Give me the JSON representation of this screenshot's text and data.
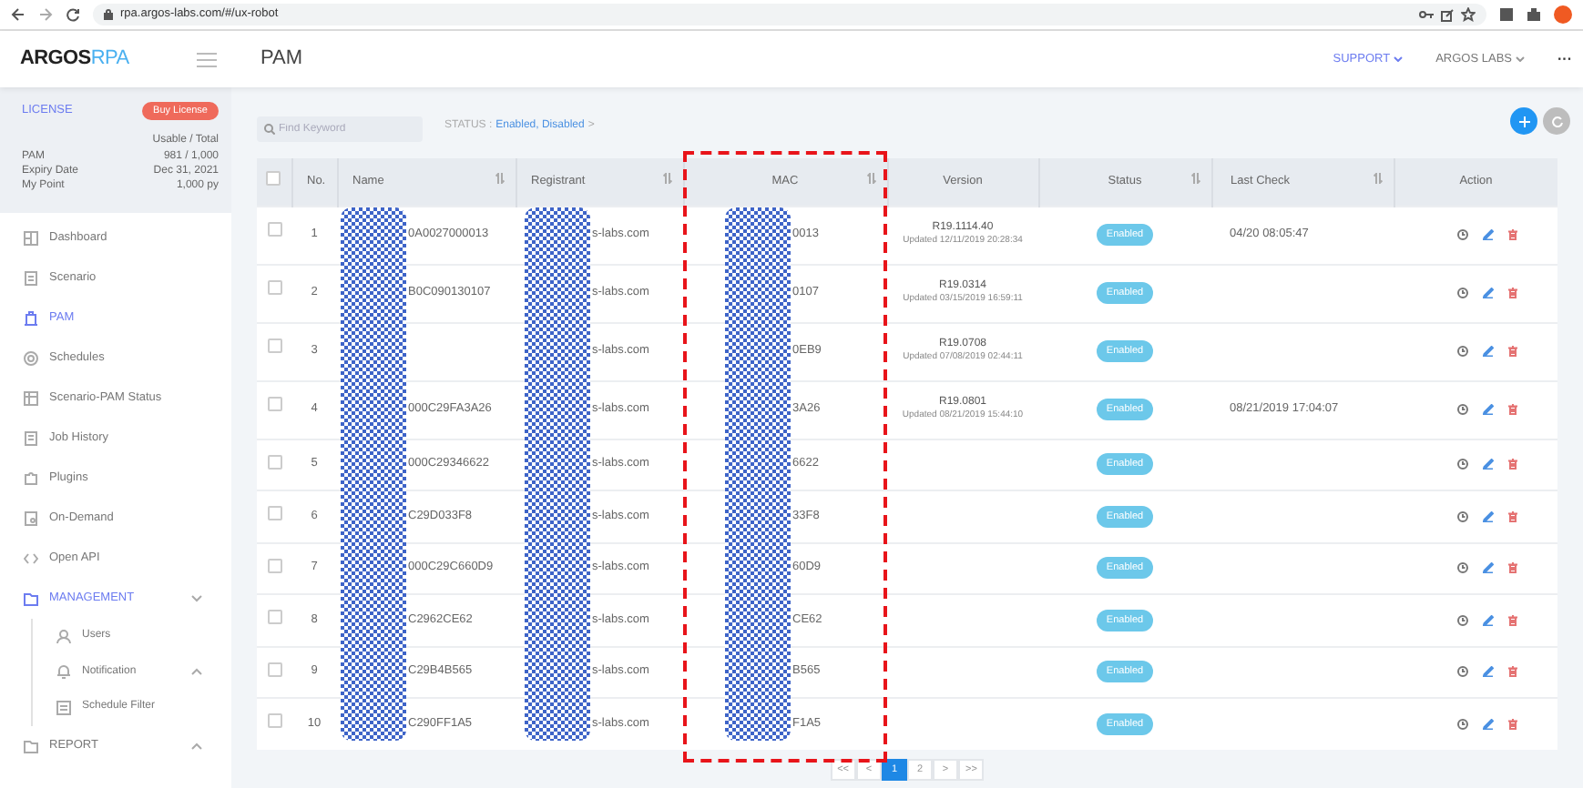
{
  "browser": {
    "url": "rpa.argos-labs.com/#/ux-robot"
  },
  "header": {
    "logo": {
      "text": "ARGOS",
      "accent": "RPA"
    },
    "title": "PAM",
    "menus": [
      {
        "label": "SUPPORT",
        "selected": true
      },
      {
        "label": "ARGOS LABS",
        "selected": false
      }
    ],
    "more": "···"
  },
  "license": {
    "title": "LICENSE",
    "buy_button": "Buy License",
    "caption": "Usable / Total",
    "rows": [
      {
        "label": "PAM",
        "value": "981 / 1,000"
      },
      {
        "label": "Expiry Date",
        "value": "Dec 31, 2021"
      },
      {
        "label": "My Point",
        "value": "1,000 py"
      }
    ]
  },
  "sidebar": {
    "items": [
      {
        "kind": "dashboard",
        "label": "Dashboard",
        "selected": false
      },
      {
        "kind": "scenario",
        "label": "Scenario",
        "selected": false
      },
      {
        "kind": "pam",
        "label": "PAM",
        "selected": true
      },
      {
        "kind": "schedules",
        "label": "Schedules",
        "selected": false
      },
      {
        "kind": "status",
        "label": "Scenario-PAM Status",
        "selected": false
      },
      {
        "kind": "history",
        "label": "Job History",
        "selected": false
      },
      {
        "kind": "plugins",
        "label": "Plugins",
        "selected": false
      },
      {
        "kind": "ondemand",
        "label": "On-Demand",
        "selected": false
      },
      {
        "kind": "api",
        "label": "Open API",
        "selected": false
      },
      {
        "kind": "folder",
        "label": "MANAGEMENT",
        "selected": true,
        "expanded": true,
        "children": [
          {
            "kind": "user",
            "label": "Users",
            "selected": false
          },
          {
            "kind": "bell",
            "label": "Notification",
            "selected": false,
            "expanded": false
          },
          {
            "kind": "filter",
            "label": "Schedule Filter",
            "selected": false
          }
        ]
      },
      {
        "kind": "folder",
        "label": "REPORT",
        "selected": false,
        "expanded": false
      }
    ]
  },
  "toolbar": {
    "search": {
      "placeholder": "Find Keyword"
    },
    "status_label": "STATUS :",
    "status_value": "Enabled, Disabled",
    "status_arrow": ">"
  },
  "table": {
    "select_all_checked": false,
    "columns": [
      {
        "kind": "check",
        "sortable": false
      },
      {
        "kind": "no",
        "label": "No.",
        "sortable": false
      },
      {
        "kind": "name",
        "label": "Name",
        "sortable": true,
        "redacted": true
      },
      {
        "kind": "registrant",
        "label": "Registrant",
        "sortable": true,
        "redacted": true
      },
      {
        "kind": "mac",
        "label": "MAC",
        "sortable": true,
        "redacted": true,
        "highlighted": true
      },
      {
        "kind": "version",
        "label": "Version",
        "sortable": false
      },
      {
        "kind": "status",
        "label": "Status",
        "sortable": true
      },
      {
        "kind": "last_check",
        "label": "Last Check",
        "sortable": true
      },
      {
        "kind": "action",
        "label": "Action",
        "sortable": false
      }
    ],
    "rows": [
      {
        "checked": false,
        "no": "1",
        "name": "0A0027000013",
        "registrant": "s-labs.com",
        "mac": "0013",
        "version": "R19.1114.40",
        "updated": "Updated 12/11/2019 20:28:34",
        "status": "Enabled",
        "last_check": "04/20 08:05:47"
      },
      {
        "checked": false,
        "no": "2",
        "name": "B0C090130107",
        "registrant": "s-labs.com",
        "mac": "0107",
        "version": "R19.0314",
        "updated": "Updated 03/15/2019 16:59:11",
        "status": "Enabled"
      },
      {
        "checked": false,
        "no": "3",
        "registrant": "s-labs.com",
        "mac": "0EB9",
        "version": "R19.0708",
        "updated": "Updated 07/08/2019 02:44:11",
        "status": "Enabled"
      },
      {
        "checked": false,
        "no": "4",
        "name": "000C29FA3A26",
        "registrant": "s-labs.com",
        "mac": "3A26",
        "version": "R19.0801",
        "updated": "Updated 08/21/2019 15:44:10",
        "status": "Enabled",
        "last_check": "08/21/2019 17:04:07"
      },
      {
        "checked": false,
        "no": "5",
        "name": "000C29346622",
        "registrant": "s-labs.com",
        "mac": "6622",
        "status": "Enabled"
      },
      {
        "checked": false,
        "no": "6",
        "name": "C29D033F8",
        "registrant": "s-labs.com",
        "mac": "33F8",
        "status": "Enabled"
      },
      {
        "checked": false,
        "no": "7",
        "name": "000C29C660D9",
        "registrant": "s-labs.com",
        "mac": "60D9",
        "status": "Enabled"
      },
      {
        "checked": false,
        "no": "8",
        "name": "C2962CE62",
        "registrant": "s-labs.com",
        "mac": "CE62",
        "status": "Enabled"
      },
      {
        "checked": false,
        "no": "9",
        "name": "C29B4B565",
        "registrant": "s-labs.com",
        "mac": "B565",
        "status": "Enabled"
      },
      {
        "checked": false,
        "no": "10",
        "name": "C290FF1A5",
        "registrant": "s-labs.com",
        "mac": "F1A5",
        "status": "Enabled"
      }
    ]
  },
  "pagination": [
    {
      "label": "<<",
      "selected": false
    },
    {
      "label": "<",
      "selected": false
    },
    {
      "label": "1",
      "selected": true
    },
    {
      "label": "2",
      "selected": false
    },
    {
      "label": ">",
      "selected": false
    },
    {
      "label": ">>",
      "selected": false
    }
  ]
}
